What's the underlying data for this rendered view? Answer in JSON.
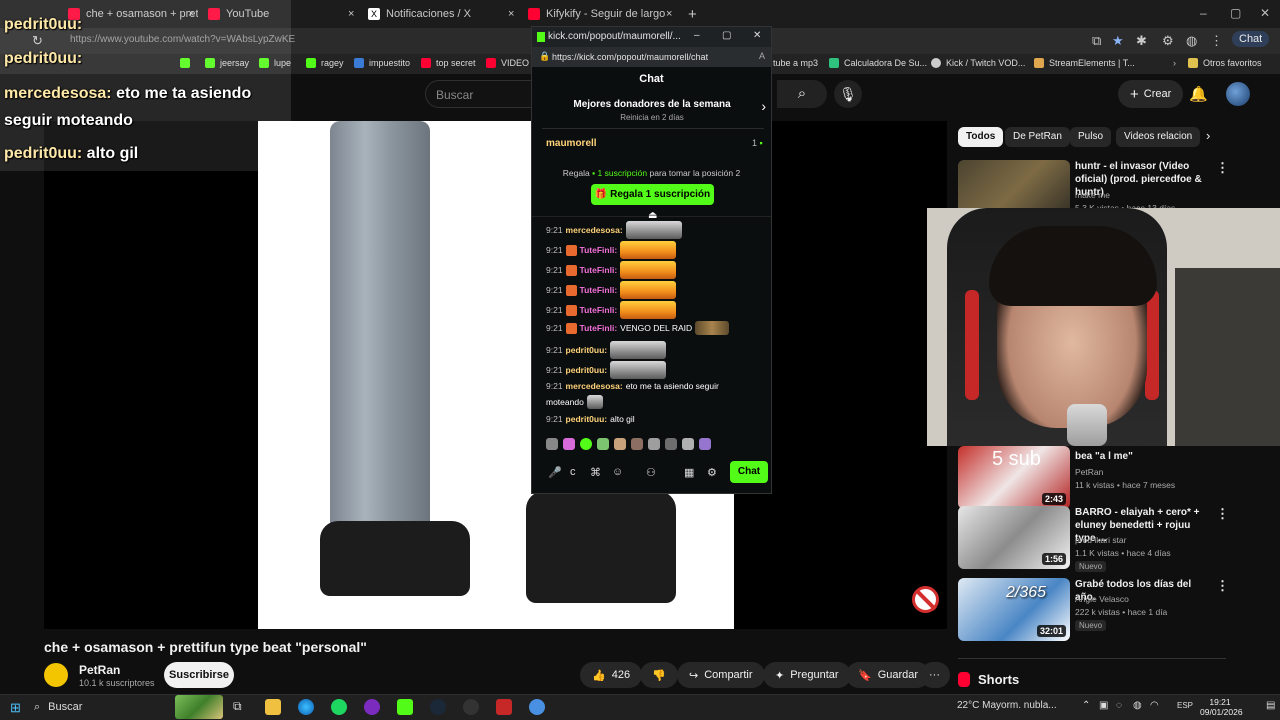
{
  "browser": {
    "tabs": [
      {
        "label": "che + osamason + prettifun type b",
        "color": "#ff0033"
      },
      {
        "label": "YouTube",
        "color": "#ff0033"
      },
      {
        "label": "Notificaciones / X",
        "color": "#ffffff"
      },
      {
        "label": "Kifykify - Seguir de largo X @Prod",
        "color": "#ff0033"
      }
    ],
    "new_tab": "+",
    "url": "https://www.youtube.com/watch?v=WAbsLypZwKE",
    "chat_button": "Chat",
    "bookmarks": [
      {
        "label": "jeersay",
        "color": "#53fc18"
      },
      {
        "label": "lupe",
        "color": "#53fc18"
      },
      {
        "label": "ragey",
        "color": "#53fc18"
      },
      {
        "label": "impuestito",
        "color": "#3a7bd5"
      },
      {
        "label": "top secret",
        "color": "#ff0033"
      },
      {
        "label": "VIDEO P",
        "color": "#ff0033"
      },
      {
        "label": "tube a mp3",
        "color": "#ffffff"
      },
      {
        "label": "Calculadora De Su...",
        "color": "#2ec27e"
      },
      {
        "label": "Kick / Twitch VOD...",
        "color": "#cccccc"
      },
      {
        "label": "StreamElements | T...",
        "color": "#e0a64f"
      },
      {
        "label": "Otros favoritos",
        "color": "#e0c04f"
      }
    ]
  },
  "overlay_chat": [
    {
      "name": "pedrit0uu:",
      "msg": ""
    },
    {
      "name": "pedrit0uu:",
      "msg": ""
    },
    {
      "name": "mercedesosa:",
      "msg": "eto me ta asiendo"
    },
    {
      "name": "",
      "msg": "seguir moteando"
    },
    {
      "name": "pedrit0uu:",
      "msg": "alto gil"
    }
  ],
  "youtube": {
    "search_placeholder": "Buscar",
    "create_label": "Crear",
    "video_title": "che + osamason + prettifun type beat \"personal\"",
    "channel": "PetRan",
    "subscribers": "10.1 k suscriptores",
    "subscribe_label": "Suscribirse",
    "likes": "426",
    "share_label": "Compartir",
    "ask_label": "Preguntar",
    "save_label": "Guardar",
    "chips": [
      "Todos",
      "De PetRan",
      "Pulso",
      "Videos relacion"
    ],
    "recommendations": [
      {
        "title": "huntr - el invasor (Video oficial) (prod. piercedfoe & huntr)",
        "channel": "make me",
        "meta": "5.3 K vistas • hace 13 días",
        "duration": "",
        "new": "",
        "color": "#6a5a3a"
      },
      {
        "title": "bea \"a l me\"",
        "channel": "PetRan",
        "meta": "11 k vistas • hace 7 meses",
        "duration": "2:43",
        "new": "",
        "color": "#c4302b"
      },
      {
        "title": "BARRO - elaiyah + cero* + eluney benedetti + rojuu type ...",
        "channel": "prod ikari star",
        "meta": "1.1 K vistas • hace 4 días",
        "duration": "1:56",
        "new": "Nuevo",
        "color": "#d9d9d9"
      },
      {
        "title": "Grabé todos los días del año.",
        "channel": "Angie Velasco",
        "meta": "222 k vistas • hace 1 día",
        "duration": "32:01",
        "new": "Nuevo",
        "color": "#4a86c5"
      }
    ],
    "shorts_label": "Shorts",
    "thumb_overlay_1": "5 sub",
    "thumb_overlay_3": "2/365"
  },
  "kick": {
    "window_title": "kick.com/popout/maumorell/...",
    "url": "https://kick.com/popout/maumorell/chat",
    "chat_title": "Chat",
    "donors_title": "Mejores donadores de la semana",
    "donors_sub": "Reinicia en 2 días",
    "top_user": "maumorell",
    "top_count": "1",
    "gift_prefix": "Regala",
    "gift_bold": "1 suscripción",
    "gift_suffix": "para tomar la posición 2",
    "gift_button": "Regala 1 suscripción",
    "send_button": "Chat",
    "input_letter": "c",
    "messages": [
      {
        "time": "9:21",
        "user": "mercedesosa:",
        "text": "",
        "emote": "face"
      },
      {
        "time": "9:21",
        "user": "TuteFinli:",
        "text": "",
        "emote": "burger"
      },
      {
        "time": "9:21",
        "user": "TuteFinli:",
        "text": "",
        "emote": "burger"
      },
      {
        "time": "9:21",
        "user": "TuteFinli:",
        "text": "",
        "emote": "burger"
      },
      {
        "time": "9:21",
        "user": "TuteFinli:",
        "text": "",
        "emote": "burger"
      },
      {
        "time": "9:21",
        "user": "TuteFinli:",
        "text": "VENGO DEL RAID",
        "emote": "leopard"
      },
      {
        "time": "9:21",
        "user": "pedrit0uu:",
        "text": "",
        "emote": "face"
      },
      {
        "time": "9:21",
        "user": "pedrit0uu:",
        "text": "",
        "emote": "face"
      },
      {
        "time": "9:21",
        "user": "mercedesosa:",
        "text": "eto me ta asiendo seguir",
        "emote": ""
      },
      {
        "time": "",
        "user": "",
        "text": "moteando",
        "emote": ""
      },
      {
        "time": "9:21",
        "user": "pedrit0uu:",
        "text": "alto gil",
        "emote": ""
      }
    ]
  },
  "taskbar": {
    "search": "Buscar",
    "weather": "22°C  Mayorm. nubla...",
    "lang": "ESP",
    "time": "19:21",
    "date": "09/01/2026"
  }
}
